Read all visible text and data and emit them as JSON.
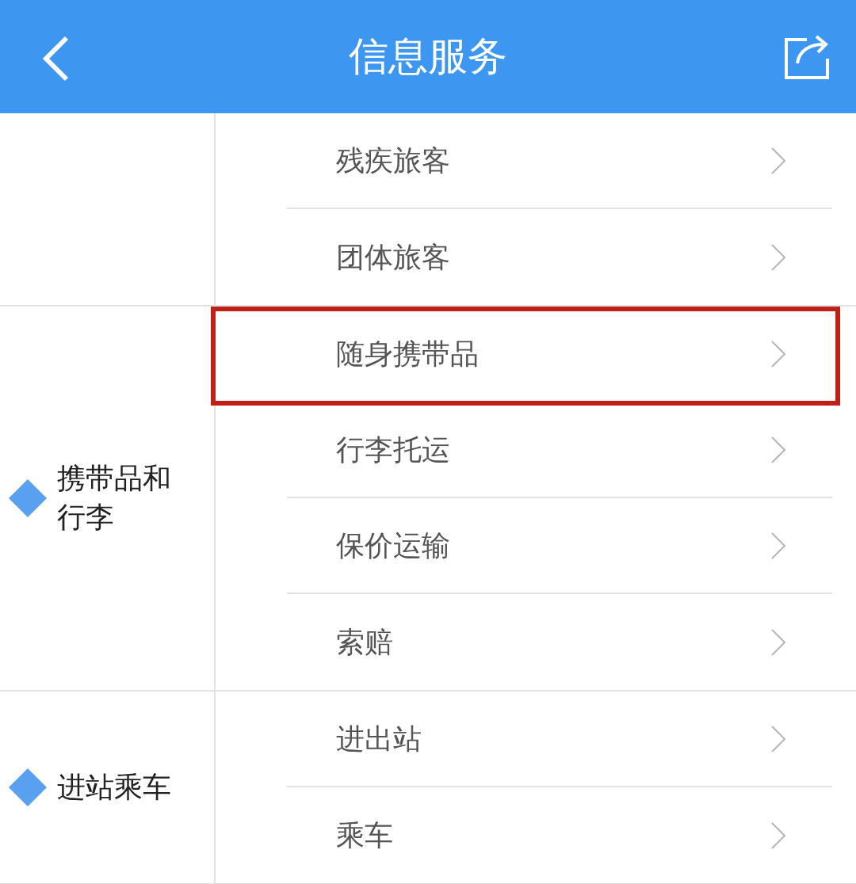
{
  "header": {
    "title": "信息服务"
  },
  "sections": [
    {
      "items": [
        {
          "label": "残疾旅客",
          "highlighted": false
        },
        {
          "label": "团体旅客",
          "highlighted": false
        }
      ]
    },
    {
      "label": "携带品和行李",
      "items": [
        {
          "label": "随身携带品",
          "highlighted": true
        },
        {
          "label": "行李托运",
          "highlighted": false
        },
        {
          "label": "保价运输",
          "highlighted": false
        },
        {
          "label": "索赔",
          "highlighted": false
        }
      ]
    },
    {
      "label": "进站乘车",
      "items": [
        {
          "label": "进出站",
          "highlighted": false
        },
        {
          "label": "乘车",
          "highlighted": false
        }
      ]
    }
  ]
}
